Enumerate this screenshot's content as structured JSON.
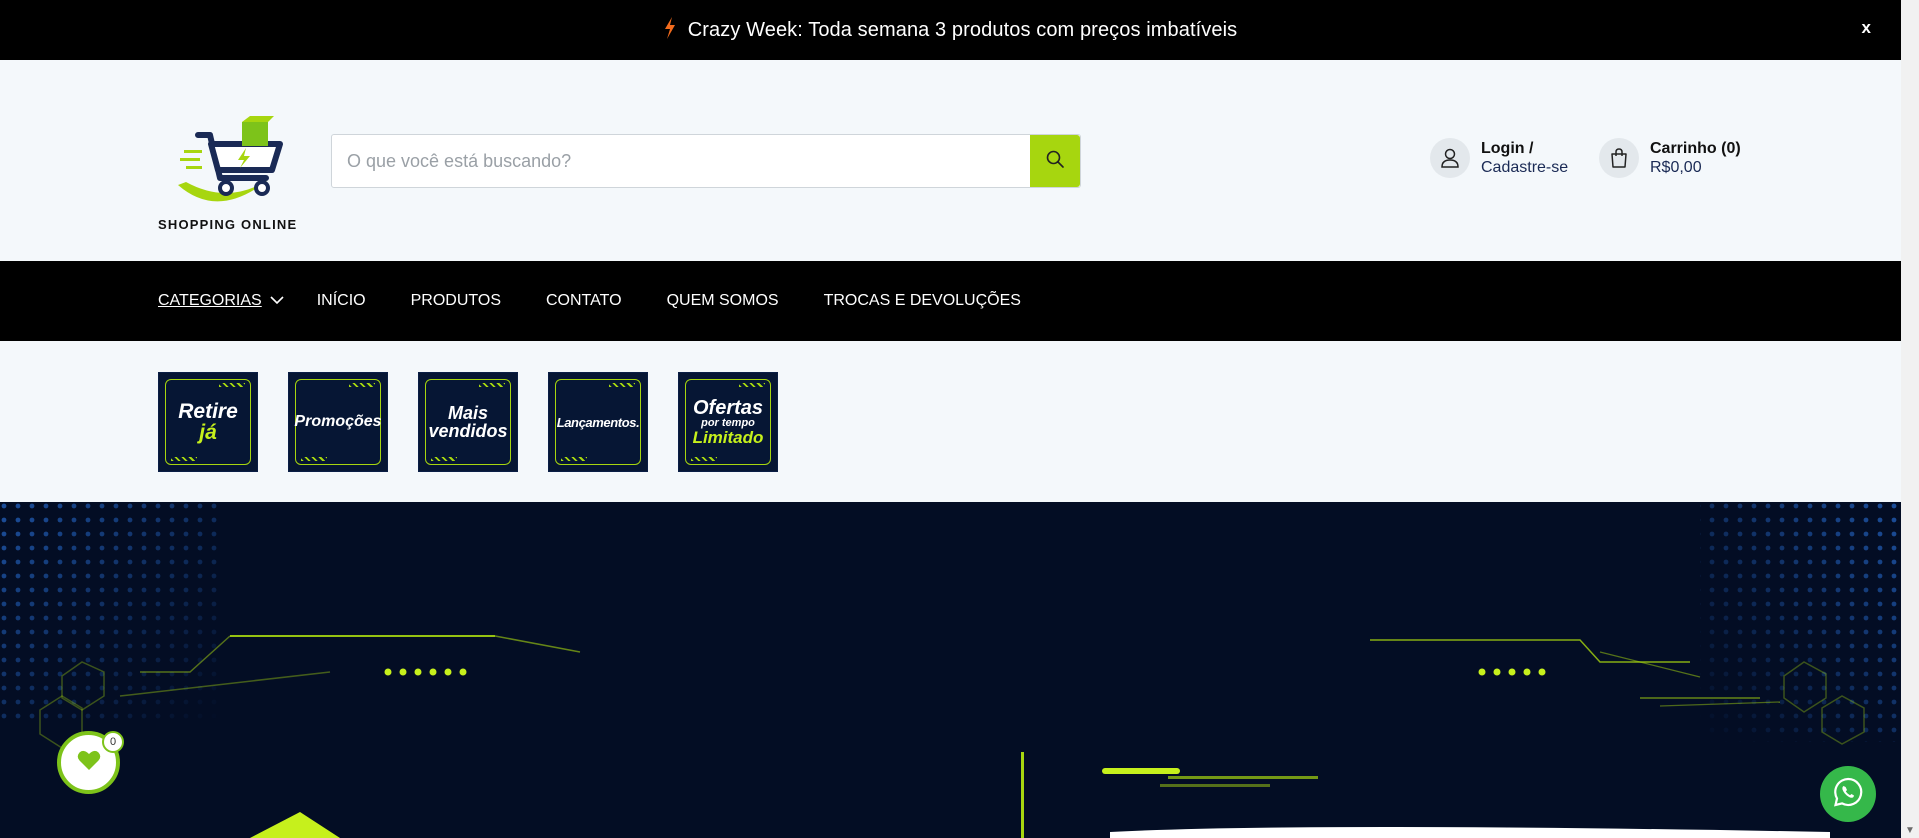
{
  "announcement": {
    "bolt_icon": "lightning-icon",
    "text": "Crazy Week: Toda semana 3 produtos com preços imbatíveis",
    "close_label": "x"
  },
  "header": {
    "logo_caption": "SHOPPING ONLINE",
    "search": {
      "placeholder": "O que você está buscando?",
      "icon": "search-icon"
    },
    "account": {
      "line1": "Login /",
      "line2": "Cadastre-se",
      "icon": "user-icon"
    },
    "cart": {
      "line1": "Carrinho (0)",
      "line2": "R$0,00",
      "icon": "shopping-bag-icon"
    }
  },
  "nav": {
    "items": [
      {
        "label": "CATEGORIAS"
      },
      {
        "label": "INÍCIO"
      },
      {
        "label": "PRODUTOS"
      },
      {
        "label": "CONTATO"
      },
      {
        "label": "QUEM SOMOS"
      },
      {
        "label": "TROCAS E DEVOLUÇÕES"
      }
    ]
  },
  "tiles": [
    {
      "line1": "Retire",
      "line2": "já"
    },
    {
      "line1": "Promoções"
    },
    {
      "line1": "Mais",
      "line2": "vendidos"
    },
    {
      "line1": "Lançamentos."
    },
    {
      "line1": "Ofertas",
      "line_mid": "por tempo",
      "line2": "Limitado"
    }
  ],
  "wishlist": {
    "count": "0",
    "icon": "heart-icon"
  },
  "whatsapp": {
    "icon": "whatsapp-icon"
  },
  "colors": {
    "accent": "#a7d60f",
    "dark": "#030d24",
    "whatsapp": "#35b84a"
  }
}
